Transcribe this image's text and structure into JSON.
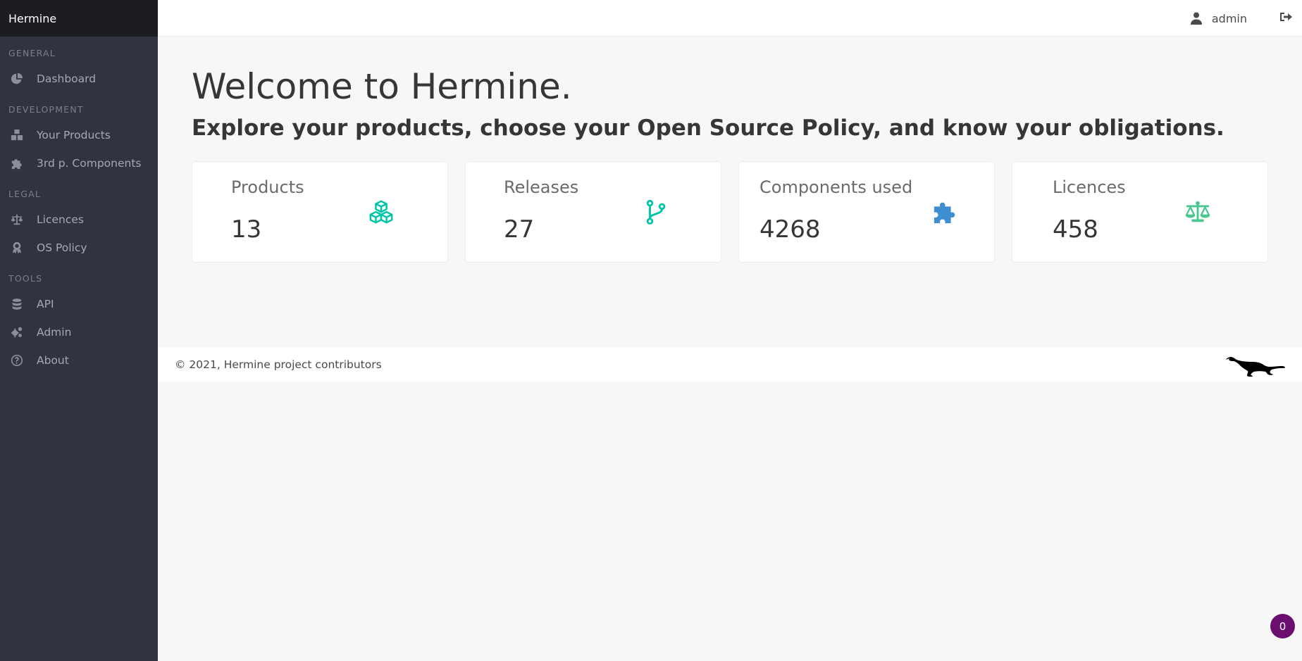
{
  "app": {
    "brand": "Hermine"
  },
  "sidebar": {
    "sections": [
      {
        "label": "GENERAL",
        "items": [
          {
            "label": "Dashboard",
            "icon": "chart-pie-icon"
          }
        ]
      },
      {
        "label": "DEVELOPMENT",
        "items": [
          {
            "label": "Your Products",
            "icon": "cubes-icon"
          },
          {
            "label": "3rd p. Components",
            "icon": "puzzle-piece-icon"
          }
        ]
      },
      {
        "label": "LEGAL",
        "items": [
          {
            "label": "Licences",
            "icon": "balance-scale-icon"
          },
          {
            "label": "OS Policy",
            "icon": "award-icon"
          }
        ]
      },
      {
        "label": "TOOLS",
        "items": [
          {
            "label": "API",
            "icon": "database-icon"
          },
          {
            "label": "Admin",
            "icon": "cogs-icon"
          },
          {
            "label": "About",
            "icon": "question-circle-icon"
          }
        ]
      }
    ]
  },
  "topbar": {
    "user": "admin",
    "user_icon": "user-icon",
    "logout_icon": "sign-out-icon"
  },
  "hero": {
    "title": "Welcome to Hermine.",
    "subtitle": "Explore your products, choose your Open Source Policy, and know your obligations."
  },
  "stats": [
    {
      "title": "Products",
      "value": "13",
      "icon": "cubes-icon",
      "color": "#00c4a7"
    },
    {
      "title": "Releases",
      "value": "27",
      "icon": "code-branch-icon",
      "color": "#00c4a7"
    },
    {
      "title": "Components used",
      "value": "4268",
      "icon": "puzzle-piece-icon",
      "color": "#3e8ed0"
    },
    {
      "title": "Licences",
      "value": "458",
      "icon": "balance-scale-icon",
      "color": "#48c78e"
    }
  ],
  "footer": {
    "copyright": "© 2021, Hermine project contributors",
    "mascot": "ermine-logo"
  },
  "notification_badge": "0"
}
